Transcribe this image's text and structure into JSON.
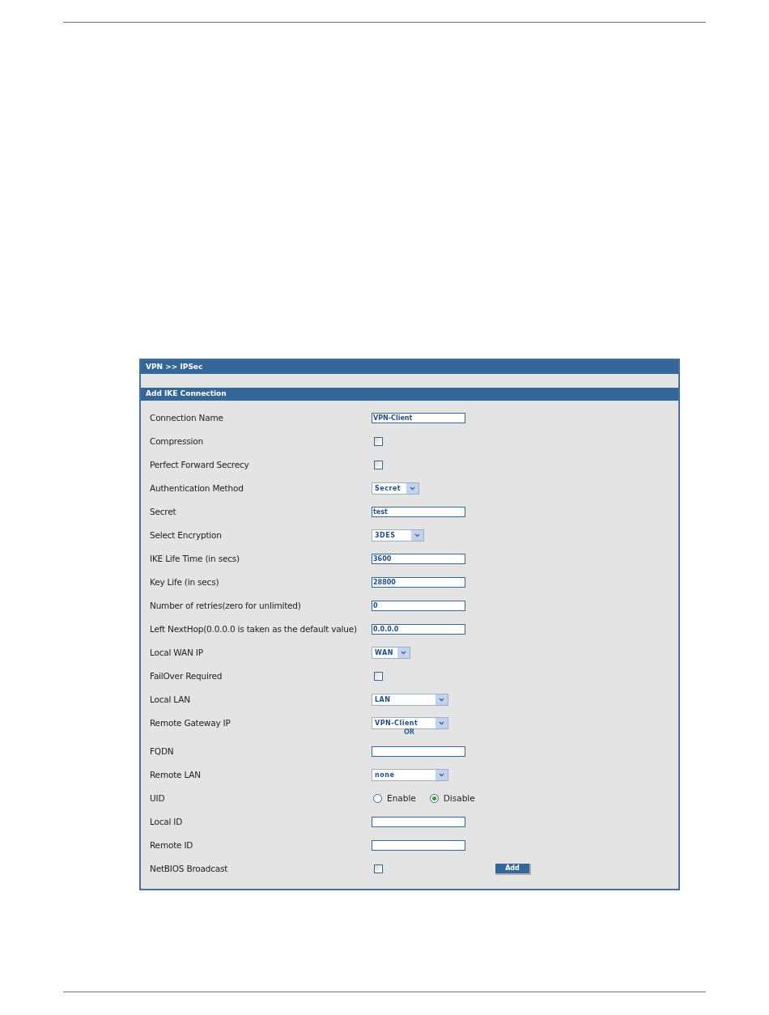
{
  "breadcrumb": "VPN >> IPSec",
  "section_title": "Add IKE Connection",
  "rows": [
    {
      "label": "Connection Name",
      "kind": "text",
      "value": "VPN-Client"
    },
    {
      "label": "Compression",
      "kind": "checkbox",
      "checked": false
    },
    {
      "label": "Perfect Forward Secrecy",
      "kind": "checkbox",
      "checked": false
    },
    {
      "label": "Authentication Method",
      "kind": "select",
      "value": "Secret"
    },
    {
      "label": "Secret",
      "kind": "text",
      "value": "test"
    },
    {
      "label": "Select Encryption",
      "kind": "select",
      "value": "3DES"
    },
    {
      "label": "IKE Life Time (in secs)",
      "kind": "text",
      "value": "3600"
    },
    {
      "label": "Key Life (in secs)",
      "kind": "text",
      "value": "28800"
    },
    {
      "label": "Number of retries(zero for unlimited)",
      "kind": "text",
      "value": "0"
    },
    {
      "label": "Left NextHop(0.0.0.0 is taken as the default value)",
      "kind": "text",
      "value": "0.0.0.0"
    },
    {
      "label": "Local WAN IP",
      "kind": "select",
      "value": "WAN"
    },
    {
      "label": "FailOver Required",
      "kind": "checkbox",
      "checked": false
    },
    {
      "label": "Local LAN",
      "kind": "select",
      "value": "LAN"
    },
    {
      "label": "Remote Gateway IP",
      "kind": "select",
      "value": "VPN-Client",
      "note": "OR"
    },
    {
      "label": "FQDN",
      "kind": "text"
    },
    {
      "label": "Remote LAN",
      "kind": "select",
      "value": "none"
    },
    {
      "label": "UID",
      "kind": "radio",
      "options": [
        {
          "label": "Enable",
          "selected": false
        },
        {
          "label": "Disable",
          "selected": true
        }
      ]
    },
    {
      "label": "Local ID",
      "kind": "text"
    },
    {
      "label": "Remote ID",
      "kind": "text"
    },
    {
      "label": "NetBIOS Broadcast",
      "kind": "checkbox",
      "checked": false
    }
  ],
  "add_button": "Add"
}
